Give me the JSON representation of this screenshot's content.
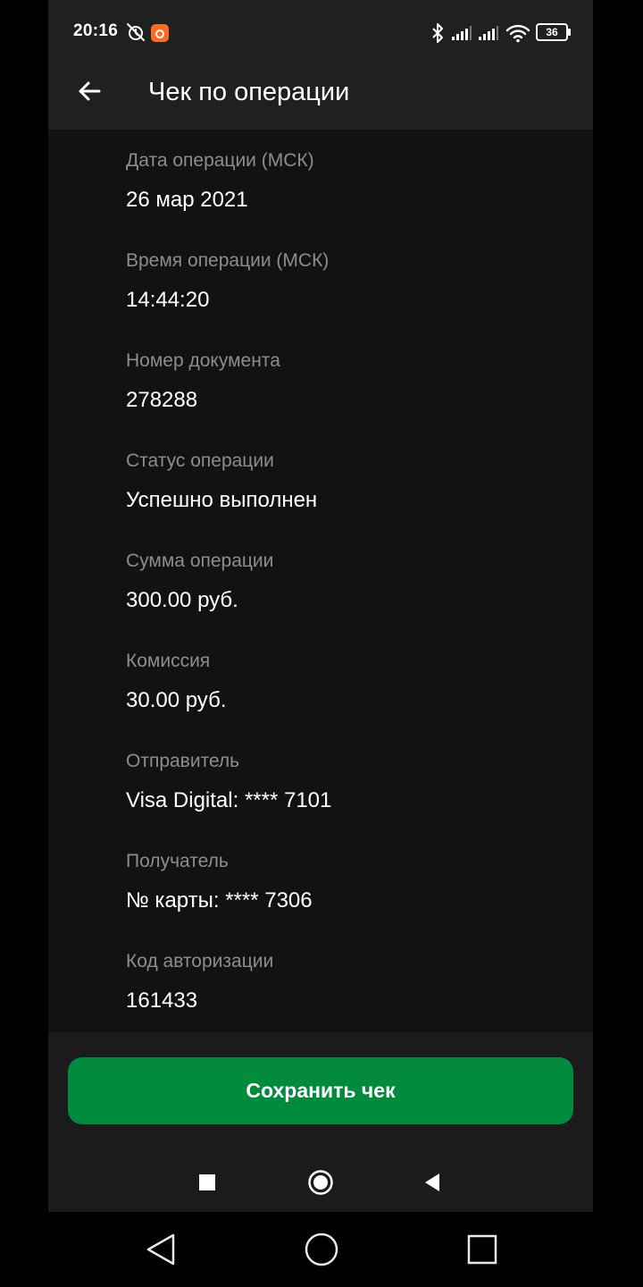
{
  "status_bar": {
    "time": "20:16",
    "battery": "36",
    "icons": [
      "alarm-off-icon",
      "app-notification-icon",
      "bluetooth-icon",
      "signal-icon",
      "signal-icon",
      "wifi-icon",
      "battery-icon"
    ]
  },
  "header": {
    "title": "Чек по операции",
    "back_icon": "arrow-left-icon"
  },
  "receipt": {
    "fields": [
      {
        "label": "Дата операции (МСК)",
        "value": "26 мар 2021"
      },
      {
        "label": "Время операции (МСК)",
        "value": "14:44:20"
      },
      {
        "label": "Номер документа",
        "value": "278288"
      },
      {
        "label": "Статус операции",
        "value": "Успешно выполнен"
      },
      {
        "label": "Сумма операции",
        "value": "300.00 руб."
      },
      {
        "label": "Комиссия",
        "value": "30.00 руб."
      },
      {
        "label": "Отправитель",
        "value": "Visa Digital: **** 7101"
      },
      {
        "label": "Получатель",
        "value": "№ карты: **** 7306"
      },
      {
        "label": "Код авторизации",
        "value": "161433"
      }
    ]
  },
  "footer": {
    "save_label": "Сохранить чек"
  },
  "colors": {
    "accent": "#038b3d",
    "background": "#121212",
    "header_bg": "#1e211f",
    "label": "#8d8d8d",
    "value": "#ffffff"
  },
  "navigation": {
    "inner": [
      "stop-square-icon",
      "home-circle-icon",
      "back-triangle-icon"
    ],
    "system": [
      "back-triangle-icon",
      "home-circle-icon",
      "recents-square-icon"
    ]
  }
}
